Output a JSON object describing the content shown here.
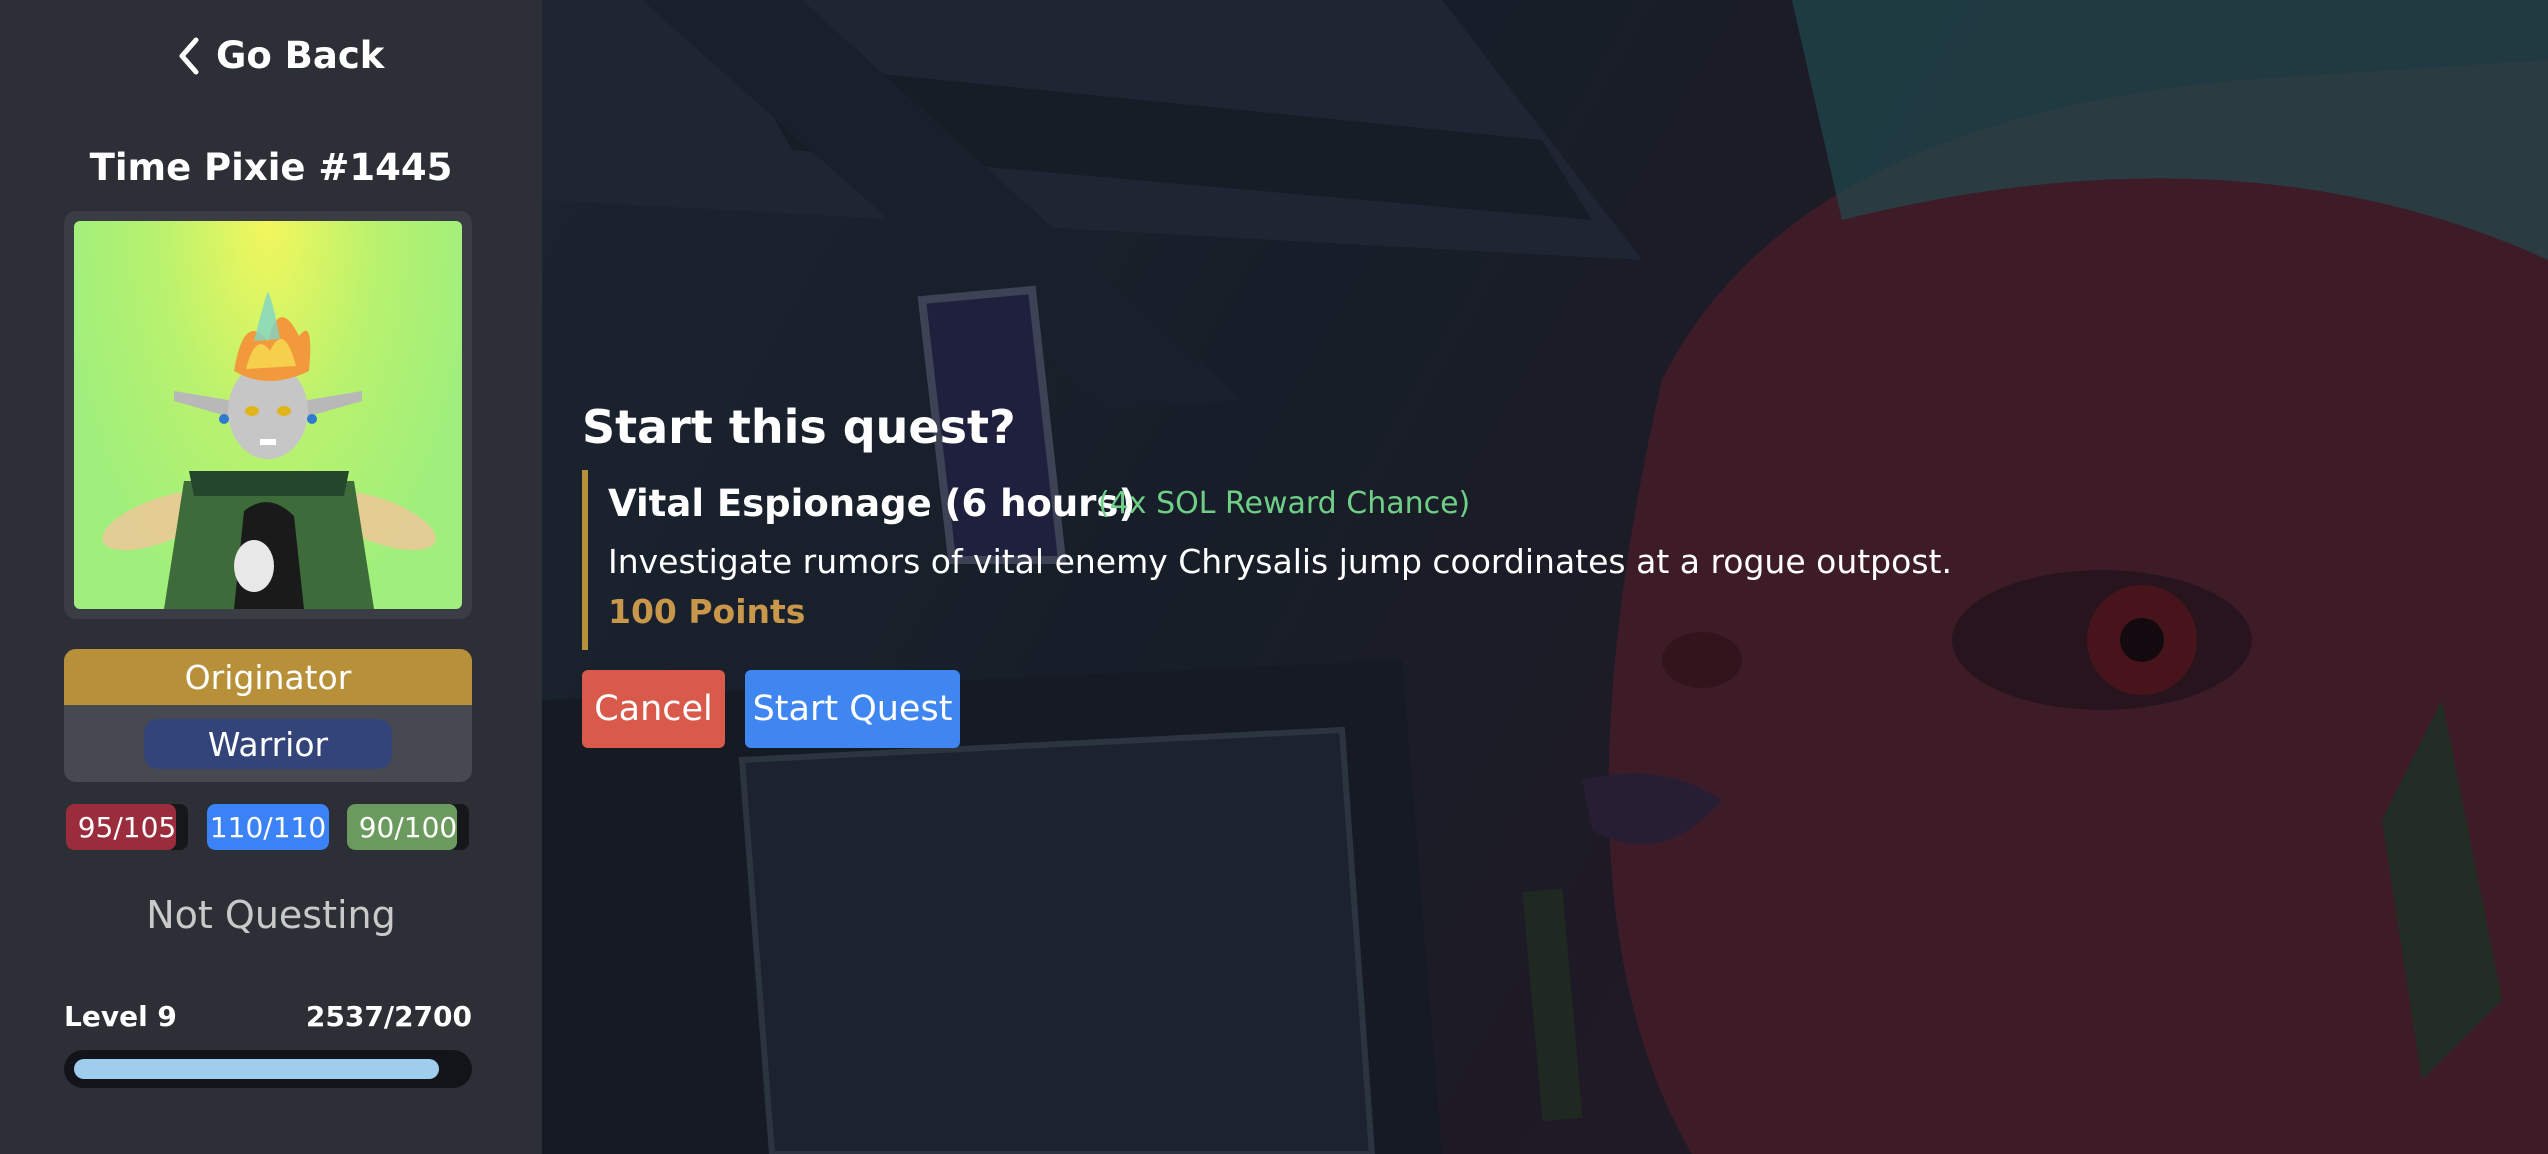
{
  "sidebar": {
    "back_label": "Go Back",
    "character_name": "Time Pixie #1445",
    "origin_tag": "Originator",
    "class_tag": "Warrior",
    "stats": [
      {
        "value": "95/105",
        "color": "#9b2c3c",
        "fraction": 0.905
      },
      {
        "value": "110/110",
        "color": "#3b82f6",
        "fraction": 1.0
      },
      {
        "value": "90/100",
        "color": "#6b9a5e",
        "fraction": 0.9
      }
    ],
    "status": "Not Questing",
    "level_label": "Level 9",
    "xp_label": "2537/2700",
    "xp_fraction": 0.94
  },
  "modal": {
    "heading": "Start this quest?",
    "quest_name": "Vital Espionage (6 hours)",
    "quest_bonus": "(4x SOL Reward Chance)",
    "quest_description": "Investigate rumors of vital enemy Chrysalis jump coordinates at a rogue outpost.",
    "quest_points": "100 Points",
    "cancel_label": "Cancel",
    "start_label": "Start Quest"
  },
  "colors": {
    "accent_gold": "#b9903a",
    "class_blue": "#33447a",
    "bonus_green": "#6fcf86",
    "cancel_red": "#d9594b",
    "start_blue": "#3f86f1"
  },
  "icons": {
    "back": "chevron-left-icon"
  }
}
